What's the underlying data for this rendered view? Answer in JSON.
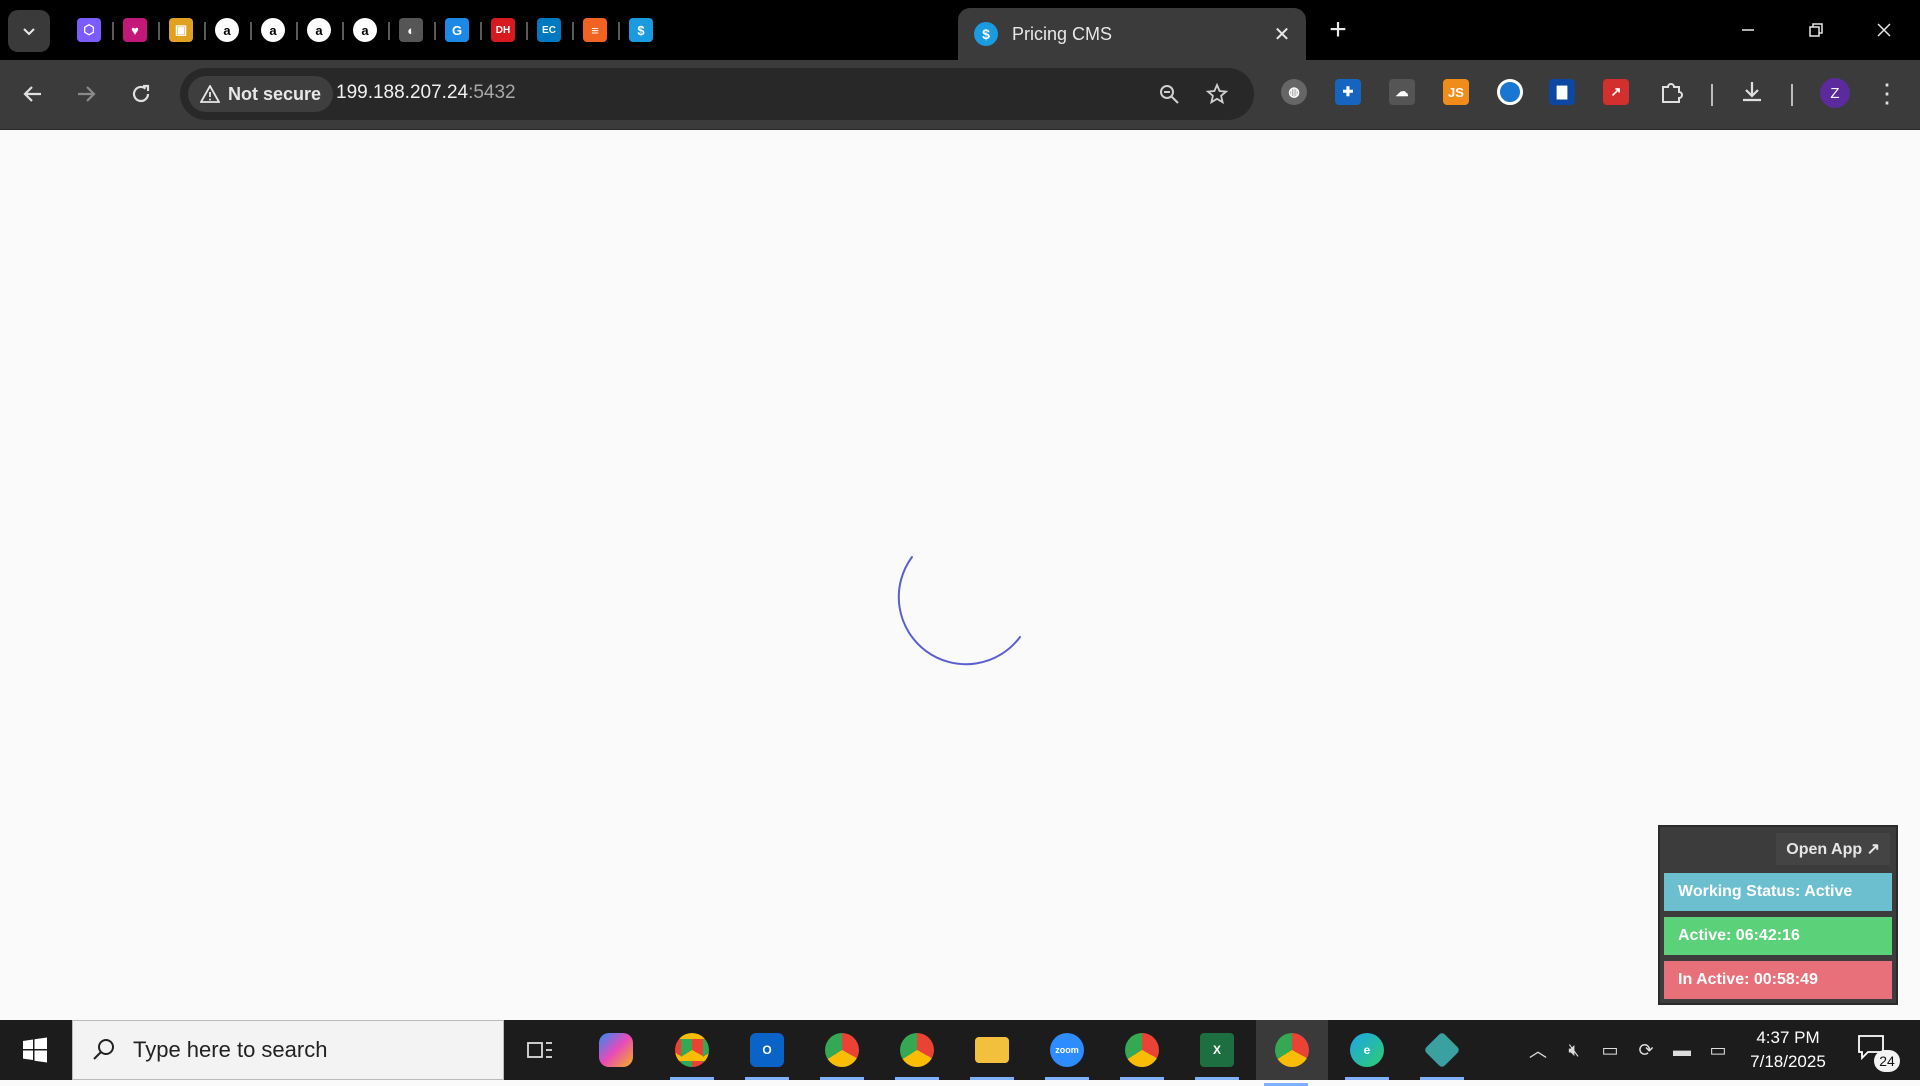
{
  "browser": {
    "active_tab_title": "Pricing CMS",
    "active_tab_favicon": "$",
    "new_tab_label": "+",
    "close_tab_label": "✕",
    "pinned_tabs": [
      {
        "name": "cube-tab-icon",
        "glyph": "⬡",
        "color": "#7b5cff"
      },
      {
        "name": "heart-tab-icon",
        "glyph": "♥",
        "color": "#c2187a"
      },
      {
        "name": "box-tab-icon",
        "glyph": "▣",
        "color": "#e0a020"
      },
      {
        "name": "amazon-tab-icon",
        "glyph": "a",
        "color": "#000000"
      },
      {
        "name": "amazon-tab-icon",
        "glyph": "a",
        "color": "#000000"
      },
      {
        "name": "amazon-tab-icon",
        "glyph": "a",
        "color": "#000000"
      },
      {
        "name": "amazon-tab-icon",
        "glyph": "a",
        "color": "#000000"
      },
      {
        "name": "globe-tab-icon",
        "glyph": "◐",
        "color": "#555555"
      },
      {
        "name": "g-tab-icon",
        "glyph": "G",
        "color": "#1e88e5"
      },
      {
        "name": "dh-tab-icon",
        "glyph": "DH",
        "color": "#d71920"
      },
      {
        "name": "ec-tab-icon",
        "glyph": "EC",
        "color": "#0079c1"
      },
      {
        "name": "stack-tab-icon",
        "glyph": "≡",
        "color": "#f26322"
      },
      {
        "name": "dollar-tab-icon",
        "glyph": "$",
        "color": "#1a9be0"
      }
    ]
  },
  "toolbar": {
    "security_label": "Not secure",
    "url_host": "199.188.207.24",
    "url_port": ":5432"
  },
  "widget": {
    "open_app_label": "Open App ↗",
    "working_status": "Working Status: Active",
    "active_time": "Active: 06:42:16",
    "inactive_time": "In Active: 00:58:49"
  },
  "taskbar": {
    "search_placeholder": "Type here to search",
    "time": "4:37 PM",
    "date": "7/18/2025",
    "notification_count": "24"
  }
}
